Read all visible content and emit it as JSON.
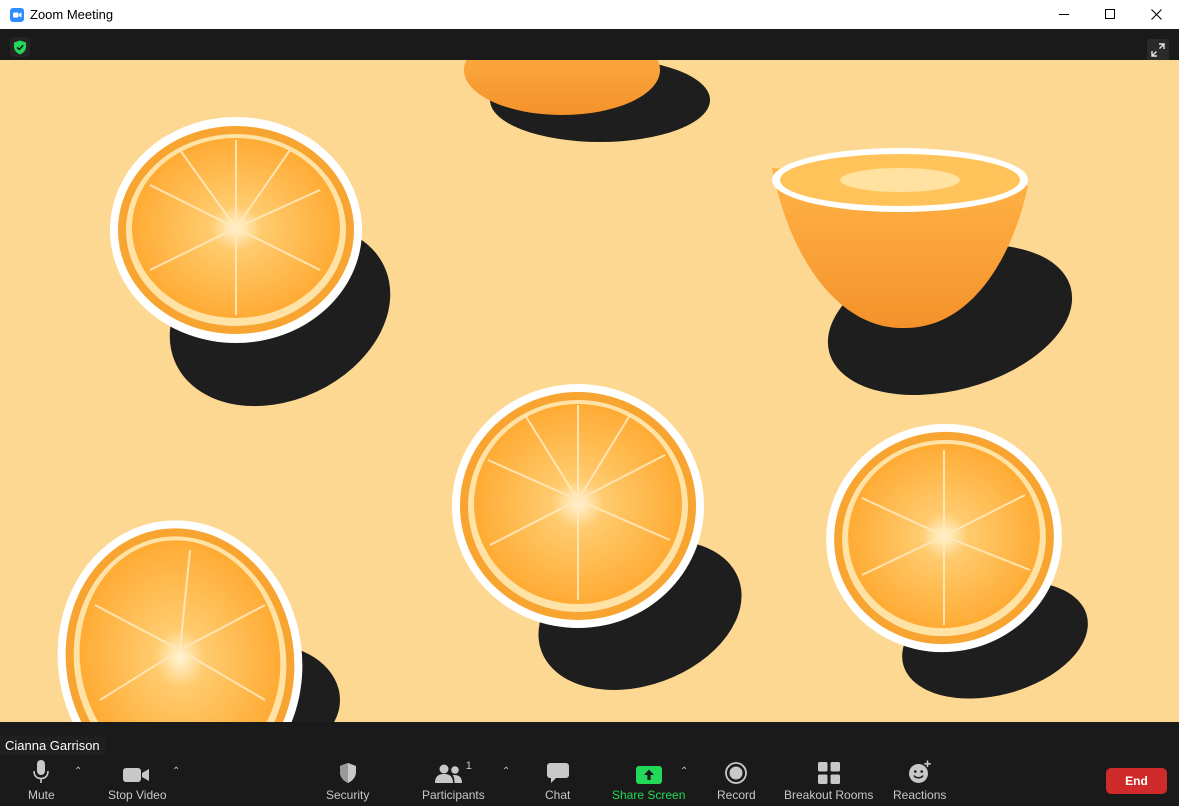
{
  "window": {
    "title": "Zoom Meeting"
  },
  "participant": {
    "name": "Cianna Garrison"
  },
  "toolbar": {
    "mute_label": "Mute",
    "stop_video_label": "Stop Video",
    "security_label": "Security",
    "participants_label": "Participants",
    "participants_count": "1",
    "chat_label": "Chat",
    "share_screen_label": "Share Screen",
    "record_label": "Record",
    "breakout_rooms_label": "Breakout Rooms",
    "reactions_label": "Reactions",
    "end_label": "End"
  },
  "icons": {
    "app": "zoom-camera-icon",
    "security_status": "shield-check-icon",
    "fullscreen": "expand-icon",
    "mute": "microphone-icon",
    "video": "video-camera-icon",
    "security": "shield-icon",
    "participants": "people-icon",
    "chat": "speech-bubble-icon",
    "share": "share-arrow-icon",
    "record": "record-icon",
    "breakout": "grid-icon",
    "reactions": "smiley-plus-icon"
  },
  "colors": {
    "background_video": "#fdd892",
    "toolbar_bg": "#1a1a1a",
    "share_green": "#23d959",
    "end_red": "#d02b2b",
    "zoom_blue": "#2d8cff"
  }
}
